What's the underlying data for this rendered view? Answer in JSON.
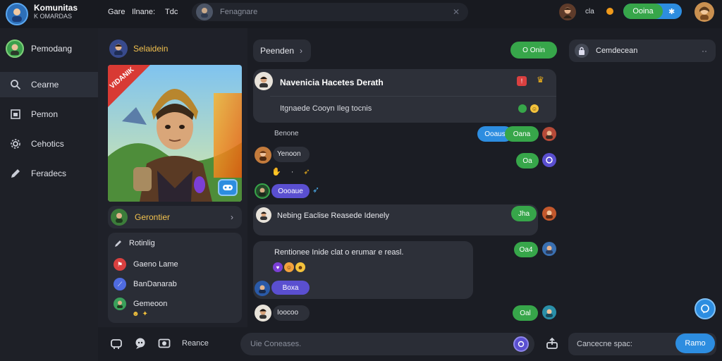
{
  "app": {
    "name_line1": "Komunitas",
    "name_line2": "K OMARDAS"
  },
  "topbar": {
    "links": [
      "Gare",
      "Ilnane:",
      "Tdc"
    ],
    "search_placeholder": "Fenagnare",
    "status_text": "cla",
    "action_label": "Ooina"
  },
  "sidebar": {
    "profile_name": "Pemodang",
    "items": [
      {
        "label": "Cearne",
        "icon": "search-icon",
        "active": true
      },
      {
        "label": "Pemon",
        "icon": "image-icon",
        "active": false
      },
      {
        "label": "Cehotics",
        "icon": "gear-icon",
        "active": false
      },
      {
        "label": "Feradecs",
        "icon": "pencil-icon",
        "active": false
      }
    ]
  },
  "channel": {
    "header_name": "Selaidein",
    "banner_text": "VIDANIK",
    "member_name": "Gerontier",
    "list_title": "Rotinlig",
    "list": [
      {
        "label": "Gaeno Lame",
        "icon": "flag-icon",
        "color": "#d94040"
      },
      {
        "label": "BanDanarab",
        "icon": "sword-icon",
        "color": "#4f6be0"
      },
      {
        "label": "Gemeoon",
        "icon": "avatar-icon",
        "color": "#3aa05a"
      }
    ]
  },
  "chat": {
    "header_label": "Peenden",
    "header_action": "O Onin",
    "pinned_title": "Navenicia Hacetes Derath",
    "pinned_sub": "Itgnaede Cooyn Ileg tocnis",
    "name_tag": "Benone",
    "reactions_top": [
      "Ooaus",
      "Oana"
    ],
    "messages": [
      {
        "author": "Yenoon",
        "badge": "Oa"
      },
      {
        "author": "Oooaue",
        "badge": ""
      },
      {
        "text": "Nebing Eaclise Reasede Idenely",
        "badge": "Jha"
      },
      {
        "text": "Rentionee Inide clat o erumar e reasl.",
        "badge": "Oa4",
        "reply": "Boxa"
      },
      {
        "author": "Ioocoo",
        "badge": "Oal"
      }
    ]
  },
  "right": {
    "header": "Cemdecean",
    "reply_placeholder": "Cancecne spac:",
    "send_label": "Ramo"
  },
  "composer": {
    "placeholder": "Uie Coneases.",
    "label": "Reance"
  },
  "colors": {
    "accent_green": "#37a64a",
    "accent_blue": "#2d8de0",
    "accent_purple": "#5a4fd0",
    "alert_red": "#d94040"
  }
}
